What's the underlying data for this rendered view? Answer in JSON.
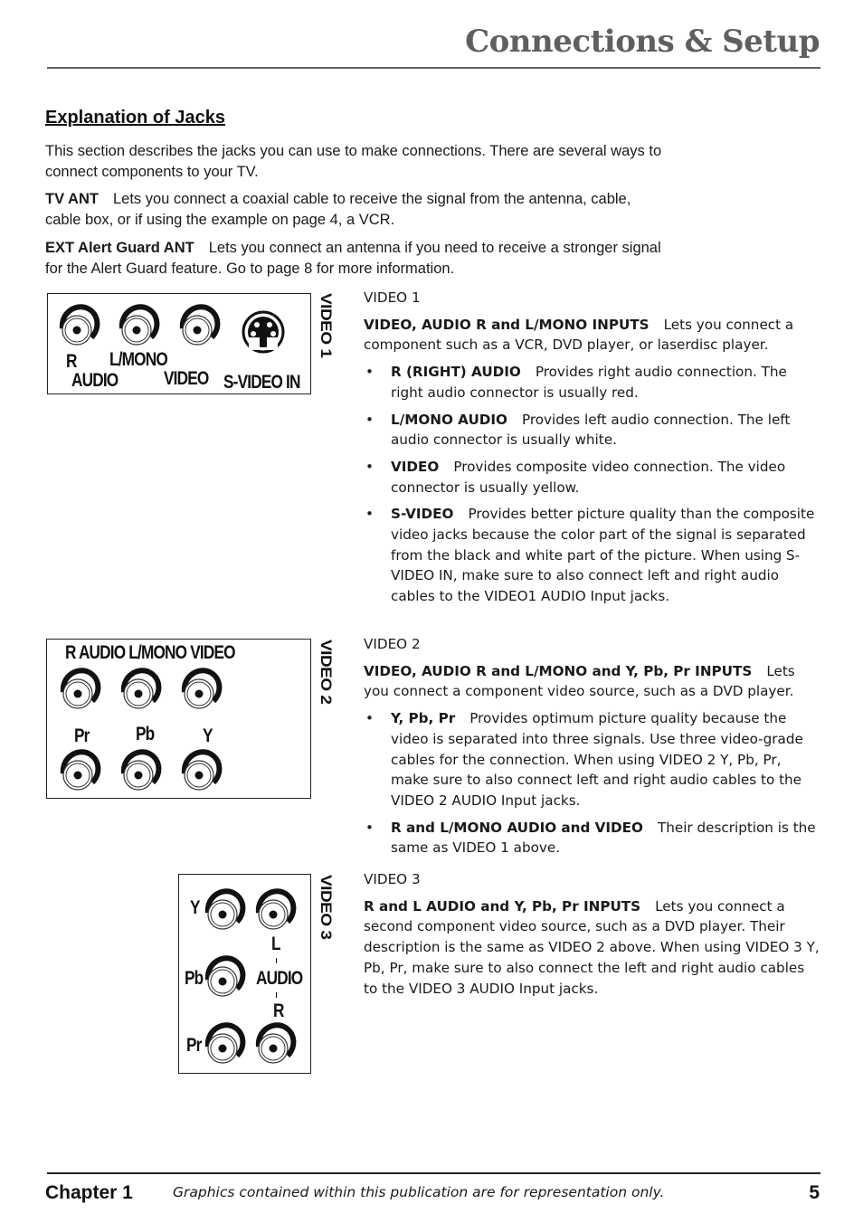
{
  "header": {
    "title": "Connections & Setup"
  },
  "intro": {
    "heading": "Explanation of Jacks",
    "paragraph": "This section describes the jacks you can use to make connections. There are several ways to connect components to your TV.",
    "items": [
      {
        "term": "TV ANT",
        "text": "Lets you connect a coaxial cable to receive the signal from the antenna, cable, cable box, or if using the example on page 4, a VCR."
      },
      {
        "term": "EXT Alert Guard ANT",
        "text": "Lets you connect an antenna if you need to receive a stronger signal for the Alert Guard feature. Go to page 8 for more information."
      }
    ]
  },
  "diagrams": {
    "video1": {
      "side_label": "VIDEO 1",
      "labels": {
        "r": "R",
        "lmono": "L/MONO",
        "audio": "AUDIO",
        "video": "VIDEO",
        "svideo": "S-VIDEO IN"
      },
      "icons": [
        "rca-jack-icon",
        "rca-jack-icon",
        "rca-jack-icon",
        "s-video-jack-icon"
      ]
    },
    "video2": {
      "side_label": "VIDEO 2",
      "top_labels": "R AUDIO L/MONO VIDEO",
      "bottom_labels": [
        "Pr",
        "Pb",
        "Y"
      ],
      "icons": [
        "rca-jack-icon"
      ]
    },
    "video3": {
      "side_label": "VIDEO 3",
      "left_labels": [
        "Y",
        "Pb",
        "Pr"
      ],
      "audio_labels": {
        "l": "L",
        "audio": "AUDIO",
        "r": "R"
      },
      "icons": [
        "rca-jack-icon"
      ]
    }
  },
  "sections": [
    {
      "title": "VIDEO 1",
      "lead_term": "VIDEO, AUDIO R and L/MONO INPUTS",
      "lead_text": "Lets you connect a component such as a VCR, DVD player, or laserdisc player.",
      "bullets": [
        {
          "term": "R (RIGHT) AUDIO",
          "text": "Provides right audio connection. The right audio connector is usually red."
        },
        {
          "term": "L/MONO AUDIO",
          "text": "Provides left audio connection. The left audio connector is usually white."
        },
        {
          "term": "VIDEO",
          "text": "Provides composite video connection. The video connector is usually yellow."
        },
        {
          "term": "S-VIDEO",
          "text": "Provides better picture quality than the composite video jacks because the color part of the signal is separated from the black and white part of the picture. When using S-VIDEO IN, make sure to also connect left and right audio cables to the VIDEO1 AUDIO Input jacks."
        }
      ]
    },
    {
      "title": "VIDEO 2",
      "lead_term": "VIDEO, AUDIO R and L/MONO and Y, Pb, Pr INPUTS",
      "lead_text": "Lets you connect a component video source, such as a DVD player.",
      "bullets": [
        {
          "term": "Y, Pb, Pr",
          "text": "Provides optimum picture quality because the video is separated into three signals. Use three video-grade cables for the connection. When using VIDEO 2 Y, Pb, Pr, make sure to also connect left and right audio cables to the VIDEO 2 AUDIO Input jacks."
        },
        {
          "term": "R and L/MONO AUDIO and VIDEO",
          "text": "Their description is the same as VIDEO 1 above."
        }
      ]
    },
    {
      "title": "VIDEO 3",
      "lead_term": "R and L AUDIO and Y, Pb, Pr INPUTS",
      "lead_text": "Lets you connect a second component video source, such as a DVD player. Their description is the same as VIDEO 2 above. When using VIDEO 3 Y, Pb, Pr, make sure to also connect the left and right audio cables to the VIDEO 3 AUDIO Input jacks.",
      "bullets": []
    }
  ],
  "footer": {
    "chapter": "Chapter 1",
    "note": "Graphics contained within this publication are for representation only.",
    "page": "5"
  },
  "bullet_glyph": "•"
}
